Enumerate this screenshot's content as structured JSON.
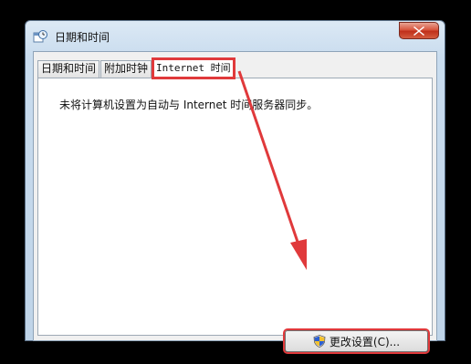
{
  "window": {
    "title": "日期和时间",
    "close_label": "✕"
  },
  "tabs": [
    {
      "label": "日期和时间"
    },
    {
      "label": "附加时钟"
    },
    {
      "label": "Internet 时间"
    }
  ],
  "panel": {
    "message": "未将计算机设置为自动与 Internet 时间服务器同步。",
    "change_button_label": "更改设置(C)..."
  },
  "annotation": {
    "color": "#e0393b"
  },
  "icons": {
    "title": "clock-calendar-icon",
    "close": "close-icon",
    "button": "uac-shield-icon"
  }
}
